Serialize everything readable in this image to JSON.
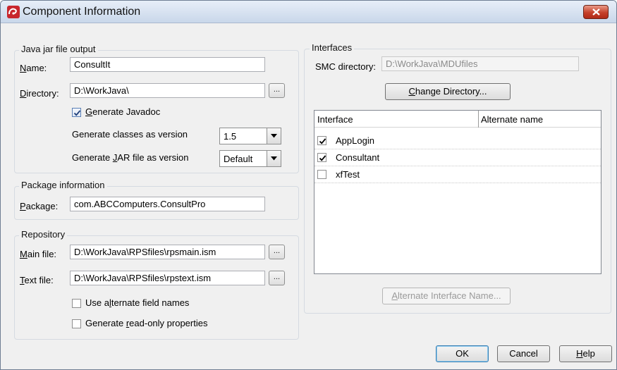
{
  "window": {
    "title": "Component Information"
  },
  "jar_output": {
    "group_label": "Java jar file output",
    "name_label": "Name:",
    "name_value": "ConsultIt",
    "directory_label": "Directory:",
    "directory_value": "D:\\WorkJava\\",
    "browse_label": "...",
    "javadoc_label": "Generate Javadoc",
    "javadoc_checked": true,
    "classes_version_label": "Generate classes as version",
    "classes_version_value": "1.5",
    "jar_version_label": "Generate JAR file as version",
    "jar_version_value": "Default"
  },
  "package_info": {
    "group_label": "Package information",
    "package_label": "Package:",
    "package_value": "com.ABCComputers.ConsultPro"
  },
  "repository": {
    "group_label": "Repository",
    "main_file_label": "Main file:",
    "main_file_value": "D:\\WorkJava\\RPSfiles\\rpsmain.ism",
    "text_file_label": "Text file:",
    "text_file_value": "D:\\WorkJava\\RPSfiles\\rpstext.ism",
    "browse_label": "...",
    "alt_field_names_label": "Use alternate field names",
    "alt_field_names_checked": false,
    "readonly_props_label": "Generate read-only properties",
    "readonly_props_checked": false
  },
  "interfaces": {
    "group_label": "Interfaces",
    "smc_label": "SMC directory:",
    "smc_value": "D:\\WorkJava\\MDUfiles",
    "change_dir_label": "Change Directory...",
    "columns": [
      "Interface",
      "Alternate name"
    ],
    "rows": [
      {
        "name": "AppLogin",
        "checked": true,
        "alternate": ""
      },
      {
        "name": "Consultant",
        "checked": true,
        "alternate": ""
      },
      {
        "name": "xfTest",
        "checked": false,
        "alternate": ""
      }
    ],
    "alt_name_button": "Alternate Interface Name..."
  },
  "buttons": {
    "ok": "OK",
    "cancel": "Cancel",
    "help": "Help"
  },
  "icons": {
    "app": "app-logo-icon",
    "close": "close-icon",
    "checkmark": "checkmark-icon",
    "dropdown": "chevron-down-icon"
  },
  "colors": {
    "title_close": "#c5402a",
    "app_icon": "#c8262d",
    "default_button_border": "#3c7fb1"
  }
}
